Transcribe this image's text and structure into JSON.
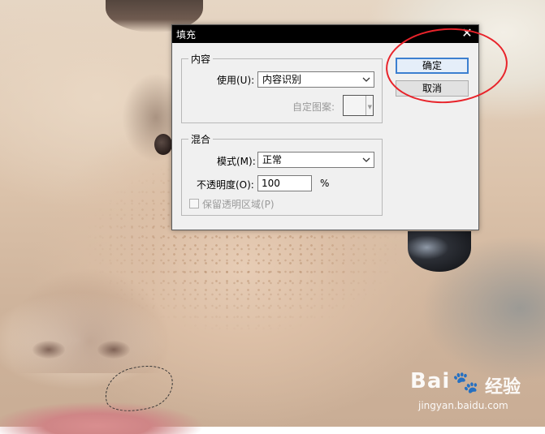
{
  "dialog": {
    "title": "填充",
    "close_glyph": "✕",
    "content_group": {
      "label": "内容",
      "use_label": "使用(U):",
      "use_value": "内容识别",
      "custom_pattern_label": "自定图案:"
    },
    "blend_group": {
      "label": "混合",
      "mode_label": "模式(M):",
      "mode_value": "正常",
      "opacity_label": "不透明度(O):",
      "opacity_value": "100",
      "opacity_unit": "%",
      "preserve_transparency_label": "保留透明区域(P)",
      "preserve_transparency_checked": false
    },
    "buttons": {
      "ok": "确定",
      "cancel": "取消"
    }
  },
  "watermark": {
    "brand": "Bai",
    "brand_suffix": "经验",
    "url": "jingyan.baidu.com"
  },
  "colors": {
    "annotation_red": "#e8232a",
    "focus_blue": "#3c7fd0",
    "titlebar": "#000000"
  }
}
